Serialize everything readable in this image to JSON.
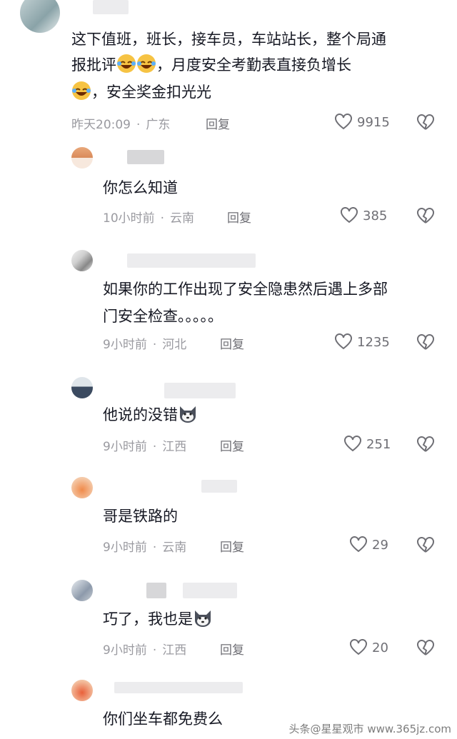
{
  "comments": [
    {
      "text_lines": [
        "这下值班，班长，接车员，车站站长，整个局通",
        "报批评",
        "，月度安全考勤表直接负增长",
        "，安全奖金扣光光"
      ],
      "time": "昨天20:09",
      "location": "广东",
      "reply_label": "回复",
      "likes": "9915"
    },
    {
      "text": "你怎么知道",
      "time": "10小时前",
      "location": "云南",
      "reply_label": "回复",
      "likes": "385"
    },
    {
      "text_lines": [
        "如果你的工作出现了安全隐患然后遇上多部",
        "门安全检查。。。。。"
      ],
      "time": "9小时前",
      "location": "河北",
      "reply_label": "回复",
      "likes": "1235"
    },
    {
      "text": "他说的没错",
      "time": "9小时前",
      "location": "江西",
      "reply_label": "回复",
      "likes": "251"
    },
    {
      "text": "哥是铁路的",
      "time": "9小时前",
      "location": "云南",
      "reply_label": "回复",
      "likes": "29"
    },
    {
      "text": "巧了，我也是",
      "time": "9小时前",
      "location": "江西",
      "reply_label": "回复",
      "likes": "20"
    },
    {
      "text": "你们坐车都免费么"
    }
  ],
  "icons": {
    "like": "heart-outline-icon",
    "dislike": "broken-heart-icon",
    "laugh": "laughing-emoji-icon",
    "husky": "husky-emoji-icon"
  },
  "watermark": "头条@星星观市 www.365jz.com"
}
